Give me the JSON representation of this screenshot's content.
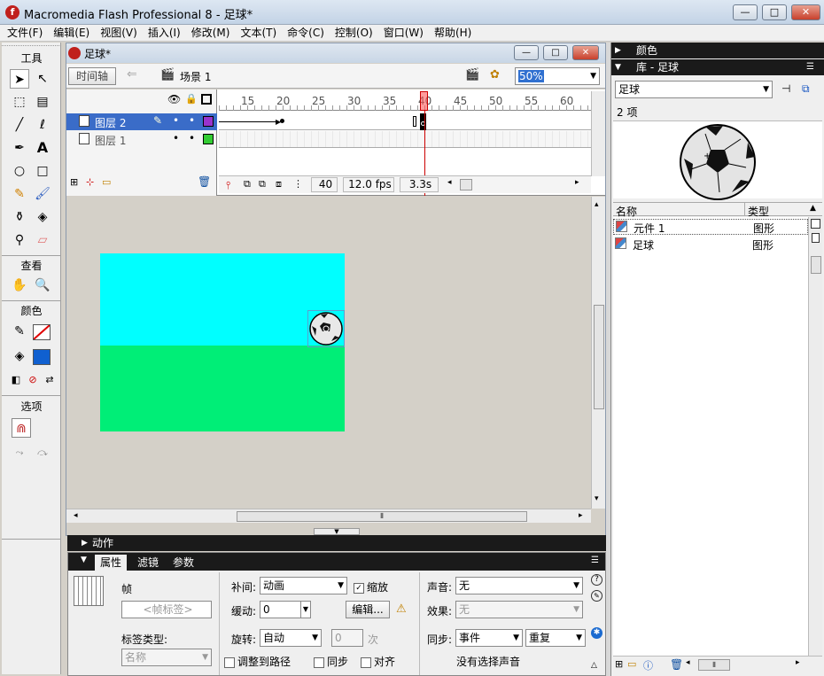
{
  "app": {
    "title": "Macromedia Flash Professional 8 - 足球*"
  },
  "window_buttons": {
    "minimize": "—",
    "maximize": "□",
    "close": "✕"
  },
  "menu": [
    "文件(F)",
    "编辑(E)",
    "视图(V)",
    "插入(I)",
    "修改(M)",
    "文本(T)",
    "命令(C)",
    "控制(O)",
    "窗口(W)",
    "帮助(H)"
  ],
  "tools": {
    "title": "工具",
    "view_title": "查看",
    "color_title": "颜色",
    "options_title": "选项"
  },
  "document": {
    "title": "足球*",
    "timeline_button": "时间轴",
    "scene_label": "场景 1",
    "zoom": "50%"
  },
  "timeline": {
    "ruler_ticks": [
      "15",
      "20",
      "25",
      "30",
      "35",
      "40",
      "45",
      "50",
      "55",
      "60"
    ],
    "layers": [
      {
        "name": "图层 2",
        "selected": true,
        "color": "#9933cc"
      },
      {
        "name": "图层 1",
        "selected": false,
        "color": "#33cc33"
      }
    ],
    "current_frame": "40",
    "fps": "12.0 fps",
    "time": "3.3s"
  },
  "stage": {
    "sky_color": "#00ffff",
    "grass_color": "#00ee77"
  },
  "right_panel": {
    "color_header": "颜色",
    "library_header": "库 - 足球",
    "library_select": "足球",
    "item_count": "2 项",
    "columns": {
      "name": "名称",
      "type": "类型"
    },
    "items": [
      {
        "name": "元件 1",
        "type": "图形"
      },
      {
        "name": "足球",
        "type": "图形"
      }
    ]
  },
  "actions_header": "动作",
  "properties": {
    "tabs": [
      "属性",
      "滤镜",
      "参数"
    ],
    "frame_label": "帧",
    "frame_label_placeholder": "<帧标签>",
    "label_type_label": "标签类型:",
    "label_type_value": "名称",
    "tween_label": "补间:",
    "tween_value": "动画",
    "scale_label": "缩放",
    "ease_label": "缓动:",
    "ease_value": "0",
    "edit_button": "编辑...",
    "rotate_label": "旋转:",
    "rotate_value": "自动",
    "rotate_count": "0",
    "rotate_unit": "次",
    "orient_label": "调整到路径",
    "sync_label": "同步",
    "snap_label": "对齐",
    "sound_label": "声音:",
    "sound_value": "无",
    "effect_label": "效果:",
    "effect_value": "无",
    "sync_sound_label": "同步:",
    "sync_sound_value": "事件",
    "repeat_value": "重复",
    "no_sound_text": "没有选择声音"
  }
}
